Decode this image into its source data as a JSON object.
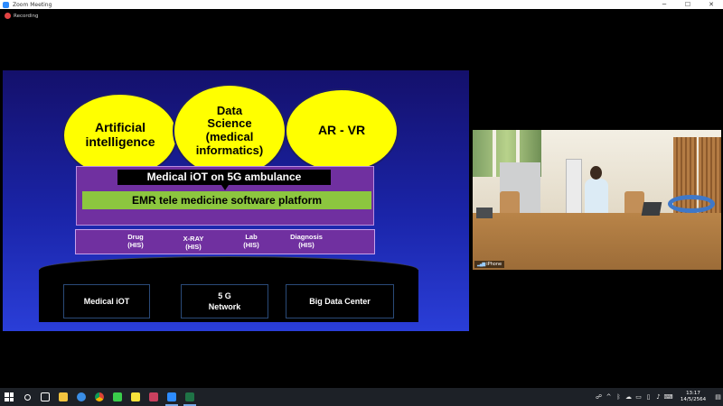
{
  "window": {
    "title": "Zoom Meeting",
    "controls": {
      "minimize": "─",
      "maximize": "☐",
      "close": "✕"
    }
  },
  "recording": {
    "label": "Recording",
    "color": "#e24343"
  },
  "slide": {
    "bubbles": [
      {
        "text": "Artificial\nintelligence"
      },
      {
        "text": "Data\nScience\n(medical\ninformatics)"
      },
      {
        "text": "AR - VR"
      }
    ],
    "iot_banner": "Medical iOT on 5G ambulance",
    "emr_platform": "EMR tele medicine software platform",
    "his_items": [
      {
        "text": "Drug\n(HIS)"
      },
      {
        "text": "X-RAY\n(HIS)"
      },
      {
        "text": "Lab\n(HIS)"
      },
      {
        "text": "Diagnosis\n(HIS)"
      }
    ],
    "database_items": [
      {
        "text": "Medical iOT"
      },
      {
        "text": "5 G\nNetwork"
      },
      {
        "text": "Big Data Center"
      }
    ],
    "colors": {
      "bubble": "#ffff00",
      "platform": "#7030a0",
      "emr": "#8cc63f",
      "background": "#1a24a8"
    }
  },
  "participant_video": {
    "name": "iPhone",
    "signal_icon": "signal-bars-icon"
  },
  "taskbar": {
    "apps": [
      {
        "icon": "windows-start-icon"
      },
      {
        "icon": "search-icon"
      },
      {
        "icon": "task-view-icon"
      },
      {
        "icon": "file-explorer-icon"
      },
      {
        "icon": "edge-browser-icon"
      },
      {
        "icon": "chrome-browser-icon"
      },
      {
        "icon": "line-chat-icon"
      },
      {
        "icon": "sticky-notes-icon"
      },
      {
        "icon": "onenote-icon"
      },
      {
        "icon": "zoom-icon"
      },
      {
        "icon": "excel-icon"
      }
    ],
    "tray": {
      "time": "13:17",
      "date": "14/5/2564"
    }
  }
}
